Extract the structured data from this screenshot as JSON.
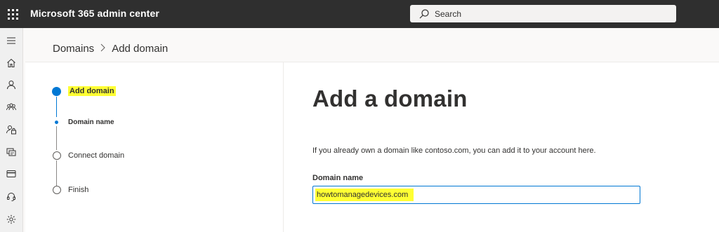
{
  "header": {
    "app_title": "Microsoft 365 admin center",
    "search_placeholder": "Search"
  },
  "nav": {
    "icons": [
      "menu-icon",
      "home-icon",
      "user-icon",
      "groups-icon",
      "roles-icon",
      "resources-icon",
      "billing-icon",
      "support-icon",
      "settings-icon"
    ]
  },
  "breadcrumb": {
    "parent": "Domains",
    "separator": ">",
    "current": "Add domain"
  },
  "stepper": {
    "steps": [
      {
        "label": "Add domain",
        "state": "active",
        "highlighted": true
      },
      {
        "label": "Domain name",
        "state": "active-substep"
      },
      {
        "label": "Connect domain",
        "state": "pending"
      },
      {
        "label": "Finish",
        "state": "pending"
      }
    ]
  },
  "main": {
    "title": "Add a domain",
    "description": "If you already own a domain like contoso.com, you can add it to your account here.",
    "domain_field_label": "Domain name",
    "domain_field_value": "howtomanagedevices.com"
  },
  "colors": {
    "accent": "#0078d4",
    "highlight": "#ffff33",
    "topbar": "#2f2f2f"
  }
}
